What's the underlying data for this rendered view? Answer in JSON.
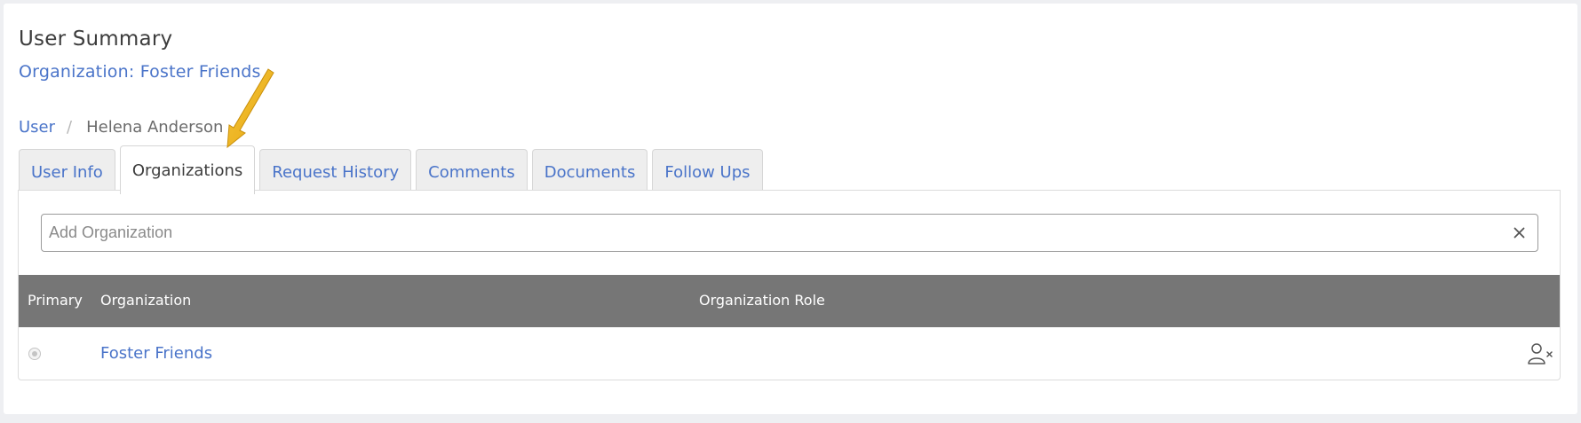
{
  "header": {
    "title": "User Summary",
    "organization_link": "Organization: Foster Friends"
  },
  "breadcrumb": {
    "parent": "User",
    "separator": "/",
    "current": "Helena Anderson"
  },
  "tabs": [
    {
      "label": "User Info",
      "active": false
    },
    {
      "label": "Organizations",
      "active": true
    },
    {
      "label": "Request History",
      "active": false
    },
    {
      "label": "Comments",
      "active": false
    },
    {
      "label": "Documents",
      "active": false
    },
    {
      "label": "Follow Ups",
      "active": false
    }
  ],
  "search": {
    "placeholder": "Add Organization",
    "value": "",
    "clear_icon": "close-icon"
  },
  "table": {
    "columns": [
      "Primary",
      "Organization",
      "Organization Role"
    ],
    "rows": [
      {
        "primary": true,
        "organization": "Foster Friends",
        "role": "",
        "action_icon": "remove-user-icon"
      }
    ]
  },
  "colors": {
    "link": "#4a74c9",
    "table_header_bg": "#767676",
    "annotation_arrow": "#f2b51c"
  }
}
